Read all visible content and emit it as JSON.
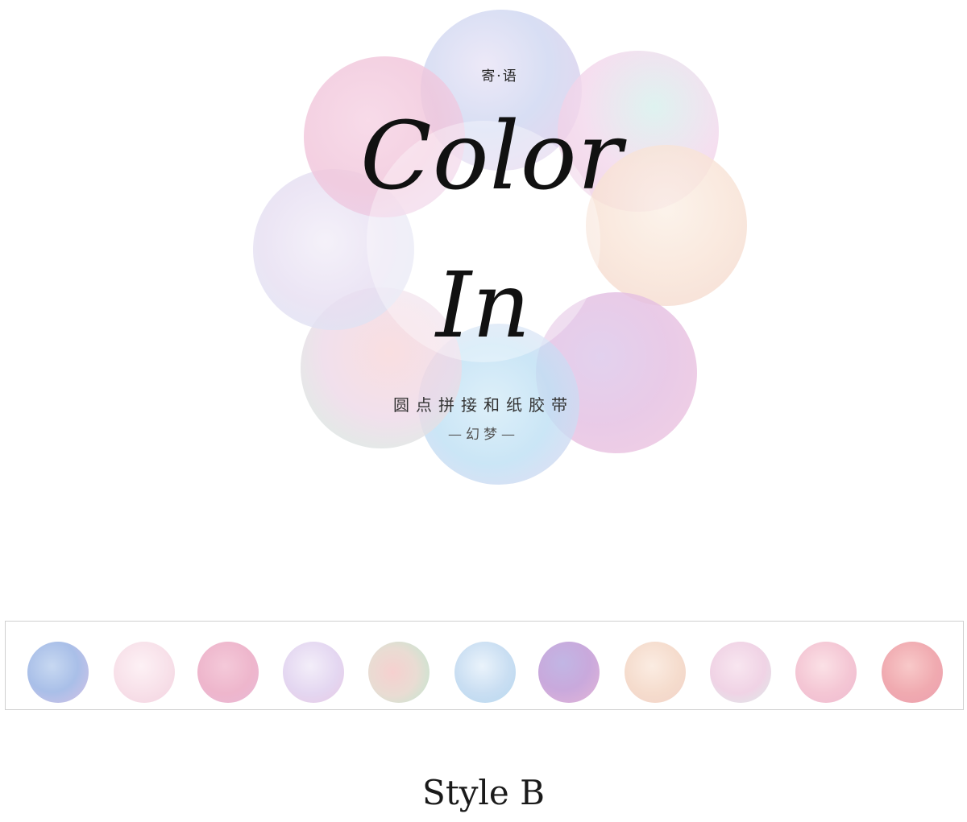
{
  "header": {
    "small_title": "寄·语",
    "script_line_1": "Color",
    "script_line_2": "In",
    "subtitle": "圆点拼接和纸胶带",
    "variant": "—幻梦—"
  },
  "tape": {
    "dot_count": 11,
    "dot_colors": [
      "#b5c7ec",
      "#f7e0ea",
      "#efb9cf",
      "#e6d9f1",
      "#e3dcd2",
      "#cadff2",
      "#c8aede",
      "#f6ddd0",
      "#f1d6e6",
      "#f4c8d6",
      "#f0adb4"
    ]
  },
  "footer": {
    "label": "Style B"
  }
}
